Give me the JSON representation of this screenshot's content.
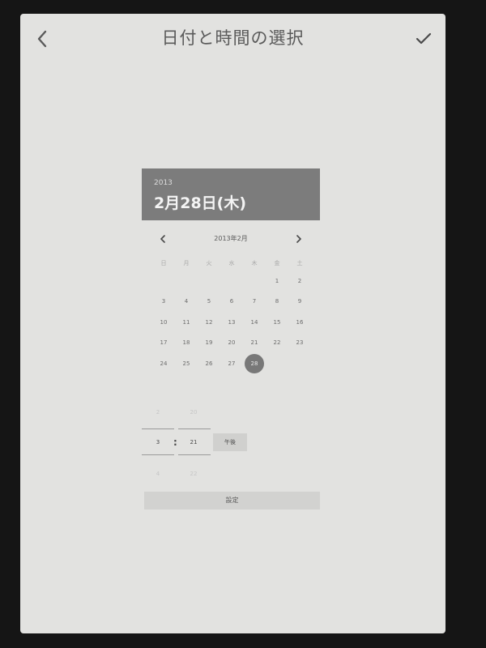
{
  "header": {
    "title": "日付と時間の選択",
    "back_icon": "chevron-left-icon",
    "confirm_icon": "check-icon"
  },
  "date_header": {
    "year": "2013",
    "full_date": "2月28日(木)"
  },
  "calendar": {
    "month_label": "2013年2月",
    "weekdays": [
      "日",
      "月",
      "火",
      "水",
      "木",
      "金",
      "土"
    ],
    "days": [
      {
        "label": "1",
        "col": 5,
        "row": 0
      },
      {
        "label": "2",
        "col": 6,
        "row": 0
      },
      {
        "label": "3",
        "col": 0,
        "row": 1
      },
      {
        "label": "4",
        "col": 1,
        "row": 1
      },
      {
        "label": "5",
        "col": 2,
        "row": 1
      },
      {
        "label": "6",
        "col": 3,
        "row": 1
      },
      {
        "label": "7",
        "col": 4,
        "row": 1
      },
      {
        "label": "8",
        "col": 5,
        "row": 1
      },
      {
        "label": "9",
        "col": 6,
        "row": 1
      },
      {
        "label": "10",
        "col": 0,
        "row": 2
      },
      {
        "label": "11",
        "col": 1,
        "row": 2
      },
      {
        "label": "12",
        "col": 2,
        "row": 2
      },
      {
        "label": "13",
        "col": 3,
        "row": 2
      },
      {
        "label": "14",
        "col": 4,
        "row": 2
      },
      {
        "label": "15",
        "col": 5,
        "row": 2
      },
      {
        "label": "16",
        "col": 6,
        "row": 2
      },
      {
        "label": "17",
        "col": 0,
        "row": 3
      },
      {
        "label": "18",
        "col": 1,
        "row": 3
      },
      {
        "label": "19",
        "col": 2,
        "row": 3
      },
      {
        "label": "20",
        "col": 3,
        "row": 3
      },
      {
        "label": "21",
        "col": 4,
        "row": 3
      },
      {
        "label": "22",
        "col": 5,
        "row": 3
      },
      {
        "label": "23",
        "col": 6,
        "row": 3
      },
      {
        "label": "24",
        "col": 0,
        "row": 4
      },
      {
        "label": "25",
        "col": 1,
        "row": 4
      },
      {
        "label": "26",
        "col": 2,
        "row": 4
      },
      {
        "label": "27",
        "col": 3,
        "row": 4
      },
      {
        "label": "28",
        "col": 4,
        "row": 4,
        "selected": true
      }
    ]
  },
  "time_picker": {
    "hour_above": "2",
    "hour": "3",
    "hour_below": "4",
    "minute_above": "20",
    "minute": "21",
    "minute_below": "22",
    "separator": ":",
    "ampm": "午後"
  },
  "set_button_label": "設定"
}
